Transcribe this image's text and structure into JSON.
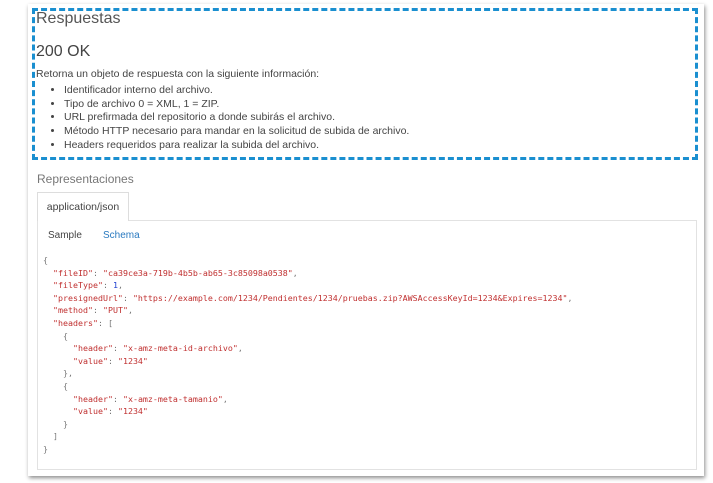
{
  "section_title": "Respuestas",
  "status": "200 OK",
  "intro": "Retorna un objeto de respuesta con la siguiente información:",
  "bullets": [
    "Identificador interno del archivo.",
    "Tipo de archivo 0 = XML, 1 = ZIP.",
    "URL prefirmada del repositorio a donde subirás el archivo.",
    "Método HTTP necesario para mandar en la solicitud de subida de archivo.",
    "Headers requeridos para realizar la subida del archivo."
  ],
  "representations_title": "Representaciones",
  "tab_label": "application/json",
  "subtabs": {
    "sample": "Sample",
    "schema": "Schema"
  },
  "colors": {
    "highlight": "#1a8fd0",
    "key": "#c03030",
    "number": "#2040d0",
    "link": "#2a7ac0"
  },
  "code_lines": [
    [
      [
        "p",
        "{"
      ]
    ],
    [
      [
        "p",
        "  "
      ],
      [
        "k",
        "\"fileID\""
      ],
      [
        "p",
        ": "
      ],
      [
        "s",
        "\"ca39ce3a-719b-4b5b-ab65-3c85098a0538\""
      ],
      [
        "p",
        ","
      ]
    ],
    [
      [
        "p",
        "  "
      ],
      [
        "k",
        "\"fileType\""
      ],
      [
        "p",
        ": "
      ],
      [
        "n",
        "1"
      ],
      [
        "p",
        ","
      ]
    ],
    [
      [
        "p",
        "  "
      ],
      [
        "k",
        "\"presignedUrl\""
      ],
      [
        "p",
        ": "
      ],
      [
        "s",
        "\"https://example.com/1234/Pendientes/1234/pruebas.zip?AWSAccessKeyId=1234&Expires=1234\""
      ],
      [
        "p",
        ","
      ]
    ],
    [
      [
        "p",
        "  "
      ],
      [
        "k",
        "\"method\""
      ],
      [
        "p",
        ": "
      ],
      [
        "s",
        "\"PUT\""
      ],
      [
        "p",
        ","
      ]
    ],
    [
      [
        "p",
        "  "
      ],
      [
        "k",
        "\"headers\""
      ],
      [
        "p",
        ": ["
      ]
    ],
    [
      [
        "p",
        "    {"
      ]
    ],
    [
      [
        "p",
        "      "
      ],
      [
        "k",
        "\"header\""
      ],
      [
        "p",
        ": "
      ],
      [
        "s",
        "\"x-amz-meta-id-archivo\""
      ],
      [
        "p",
        ","
      ]
    ],
    [
      [
        "p",
        "      "
      ],
      [
        "k",
        "\"value\""
      ],
      [
        "p",
        ": "
      ],
      [
        "s",
        "\"1234\""
      ]
    ],
    [
      [
        "p",
        "    },"
      ]
    ],
    [
      [
        "p",
        "    {"
      ]
    ],
    [
      [
        "p",
        "      "
      ],
      [
        "k",
        "\"header\""
      ],
      [
        "p",
        ": "
      ],
      [
        "s",
        "\"x-amz-meta-tamanio\""
      ],
      [
        "p",
        ","
      ]
    ],
    [
      [
        "p",
        "      "
      ],
      [
        "k",
        "\"value\""
      ],
      [
        "p",
        ": "
      ],
      [
        "s",
        "\"1234\""
      ]
    ],
    [
      [
        "p",
        "    }"
      ]
    ],
    [
      [
        "p",
        "  ]"
      ]
    ],
    [
      [
        "p",
        "}"
      ]
    ]
  ]
}
